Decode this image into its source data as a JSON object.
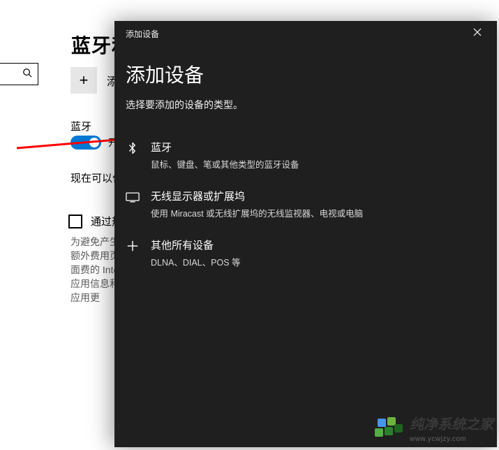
{
  "underlay": {
    "title": "蓝牙和",
    "addLabel": "添",
    "sectionLabel": "蓝牙",
    "toggleLabel": "开",
    "discoverable": "现在可以作",
    "checkboxLabel": "通过热",
    "paragraph": "为避免产生额外费用页面费的 Intel应用信息和应用更"
  },
  "dialog": {
    "headerTitle": "添加设备",
    "title": "添加设备",
    "subtitle": "选择要添加的设备的类型。",
    "options": [
      {
        "label": "蓝牙",
        "desc": "鼠标、键盘、笔或其他类型的蓝牙设备"
      },
      {
        "label": "无线显示器或扩展坞",
        "desc": "使用 Miracast 或无线扩展坞的无线监视器、电视或电脑"
      },
      {
        "label": "其他所有设备",
        "desc": "DLNA、DIAL、POS 等"
      }
    ]
  },
  "watermark": {
    "title": "纯净系统之家",
    "url": "www.ycwjzy.com"
  }
}
